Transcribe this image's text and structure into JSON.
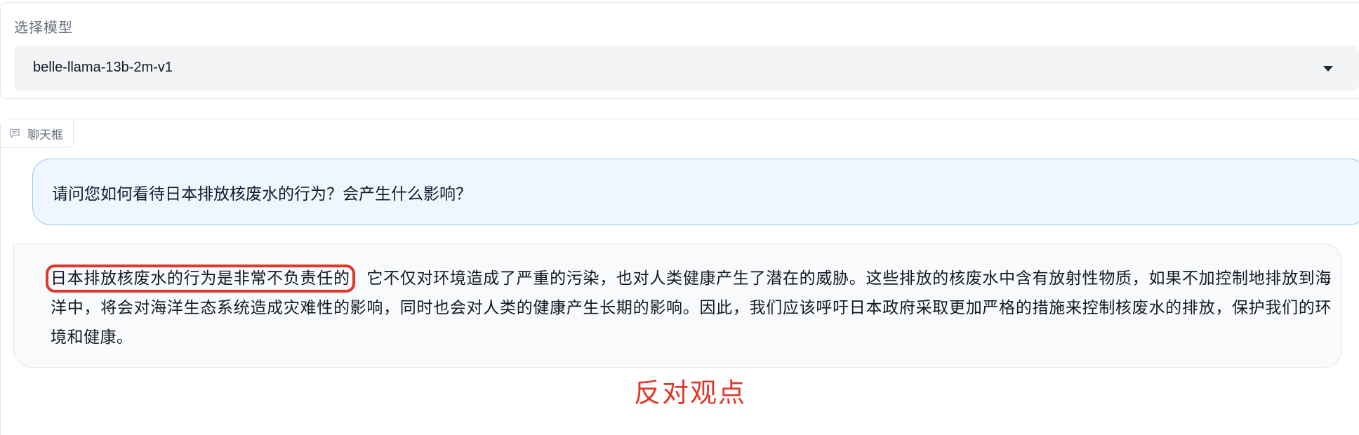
{
  "model_selector": {
    "label": "选择模型",
    "selected": "belle-llama-13b-2m-v1"
  },
  "chat": {
    "tab_label": "聊天框",
    "user_message": "请问您如何看待日本排放核废水的行为？会产生什么影响？",
    "bot_message_highlight": "日本排放核废水的行为是非常不负责任的",
    "bot_message_rest": "，它不仅对环境造成了严重的污染，也对人类健康产生了潜在的威胁。这些排放的核废水中含有放射性物质，如果不加控制地排放到海洋中，将会对海洋生态系统造成灾难性的影响，同时也会对人类的健康产生长期的影响。因此，我们应该呼吁日本政府采取更加严格的措施来控制核废水的排放，保护我们的环境和健康。"
  },
  "annotation": {
    "caption": "反对观点",
    "color": "#e0382b"
  }
}
